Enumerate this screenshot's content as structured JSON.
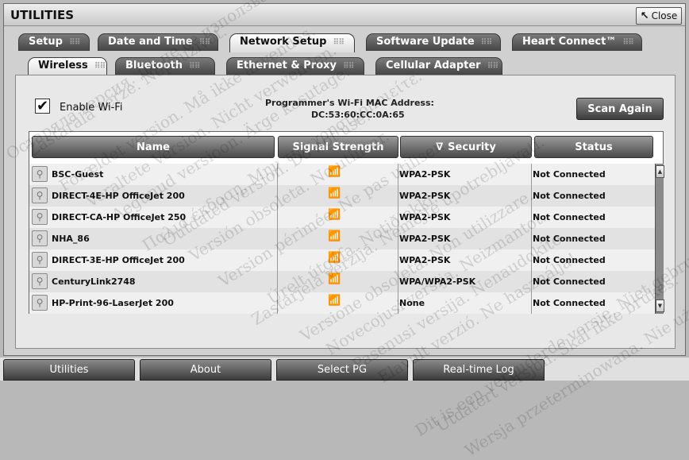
{
  "window": {
    "title": "UTILITIES",
    "close_label": "Close"
  },
  "tabs": [
    {
      "label": "Setup",
      "active": false
    },
    {
      "label": "Date and Time",
      "active": false
    },
    {
      "label": "Network Setup",
      "active": true
    },
    {
      "label": "Software Update",
      "active": false
    },
    {
      "label": "Heart Connect™",
      "active": false
    }
  ],
  "subtabs": [
    {
      "label": "Wireless",
      "active": true
    },
    {
      "label": "Bluetooth",
      "active": false
    },
    {
      "label": "Ethernet & Proxy",
      "active": false
    },
    {
      "label": "Cellular Adapter",
      "active": false
    }
  ],
  "wifi": {
    "enable_label": "Enable Wi-Fi",
    "enabled": true,
    "mac_title": "Programmer's Wi-Fi MAC Address:",
    "mac_value": "DC:53:60:CC:0A:65",
    "scan_label": "Scan Again"
  },
  "table": {
    "columns": [
      "Name",
      "Signal Strength",
      "Security",
      "Status"
    ],
    "sorted_column": "Security",
    "rows": [
      {
        "name": "BSC-Guest",
        "security": "WPA2-PSK",
        "status": "Not Connected"
      },
      {
        "name": "DIRECT-4E-HP OfficeJet 200",
        "security": "WPA2-PSK",
        "status": "Not Connected"
      },
      {
        "name": "DIRECT-CA-HP OfficeJet 250",
        "security": "WPA2-PSK",
        "status": "Not Connected"
      },
      {
        "name": "NHA_86",
        "security": "WPA2-PSK",
        "status": "Not Connected"
      },
      {
        "name": "DIRECT-3E-HP OfficeJet 200",
        "security": "WPA2-PSK",
        "status": "Not Connected"
      },
      {
        "name": "CenturyLink2748",
        "security": "WPA/WPA2-PSK",
        "status": "Not Connected"
      },
      {
        "name": "HP-Print-96-LaserJet 200",
        "security": "None",
        "status": "Not Connected"
      }
    ]
  },
  "nav": [
    {
      "label": "Utilities"
    },
    {
      "label": "About"
    },
    {
      "label": "Select PG"
    },
    {
      "label": "Real-time Log"
    }
  ],
  "watermark": [
    "Остаряла версия. Да не се използва.",
    "Zastaralá verze. Nepoužívat.",
    "Forældet version. Må ikke anvendes.",
    "Veraltete Version. Nicht verwenden.",
    "Aegunud versioon. Ärge kasutage.",
    "Παλιά έκδοση. Μην την χρησιμοποιείτε.",
    "Outdated version. Do not use.",
    "Versión obsoleta. No utilizar.",
    "Version périmée. Ne pas utiliser.",
    "Zastarjela verzija. Nemojte upotrebljavati.",
    "Úrelt útgáfa. Notið ekki.",
    "Versione obsoleta. Non utilizzare.",
    "Novecojusi versija. Neizmantot.",
    "Pasenusi versija. Nenaudokite.",
    "Elavult verzió. Ne használja!",
    "Dit is een verouderde versie. Niet gebruiken.",
    "Utdatert versjon. Skal ikke brukes.",
    "Wersja przeterminowana. Nie używać."
  ],
  "colors": {
    "tab_dark": "#454545",
    "panel": "#e8e8e8"
  }
}
